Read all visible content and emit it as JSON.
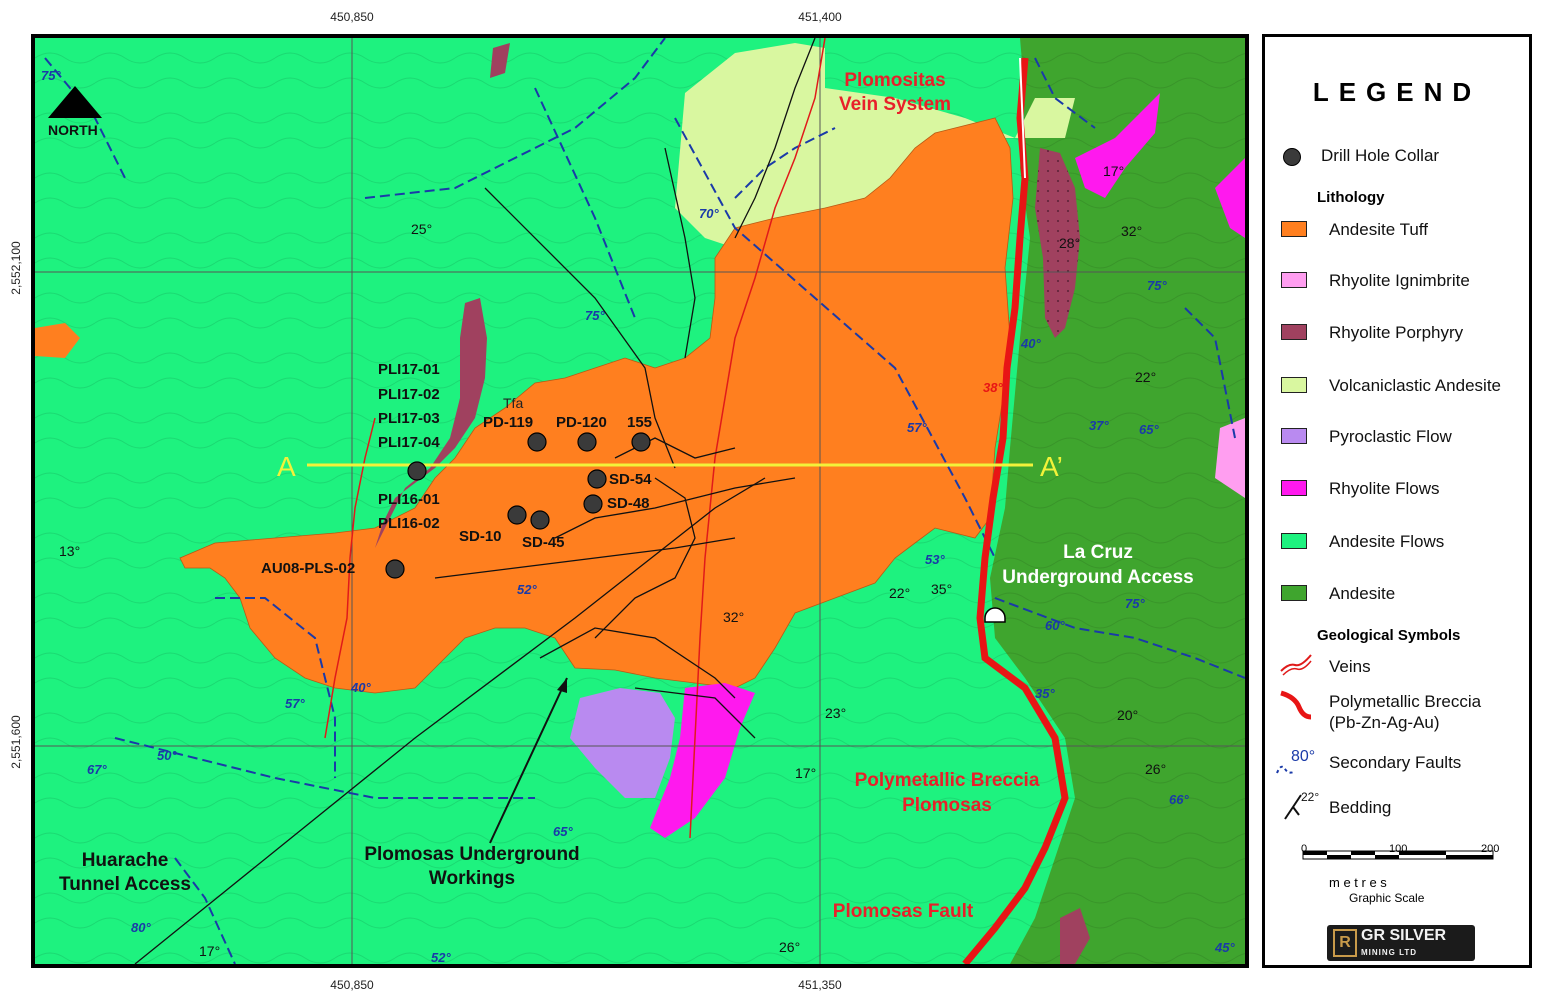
{
  "grid": {
    "top_labels": [
      "450,850",
      "451,400"
    ],
    "bottom_labels": [
      "450,850",
      "451,350"
    ],
    "left_labels": [
      "2,552,100",
      "2,551,600"
    ]
  },
  "north": {
    "label": "NORTH"
  },
  "places": {
    "plomositas": [
      "Plomositas",
      "Vein System"
    ],
    "breccia": [
      "Polymetallic Breccia",
      "Plomosas"
    ],
    "fault": "Plomosas Fault",
    "la_cruz": [
      "La Cruz",
      "Underground Access"
    ],
    "huarache": [
      "Huarache",
      "Tunnel Access"
    ],
    "workings": [
      "Plomosas Underground",
      "Workings"
    ]
  },
  "section": {
    "a": "A",
    "a_prime": "A’"
  },
  "unit_label": "Tfa",
  "drill_labels": {
    "pli17_01": "PLI17-01",
    "pli17_02": "PLI17-02",
    "pli17_03": "PLI17-03",
    "pli17_04": "PLI17-04",
    "pli16_01": "PLI16-01",
    "pli16_02": "PLI16-02",
    "pd119": "PD-119",
    "pd120": "PD-120",
    "h155": "155",
    "sd54": "SD-54",
    "sd48": "SD-48",
    "sd10": "SD-10",
    "sd45": "SD-45",
    "au08": "AU08-PLS-02"
  },
  "fault_dips": [
    "75°",
    "70°",
    "75°",
    "57°",
    "53°",
    "40°",
    "57°",
    "50°",
    "67°",
    "65°",
    "80°",
    "52°",
    "52°",
    "38°",
    "40°",
    "75°",
    "37°",
    "65°",
    "60°",
    "75°",
    "35°",
    "66°",
    "45°"
  ],
  "bedding_dips": [
    "25°",
    "13°",
    "17°",
    "23°",
    "22°",
    "35°",
    "32°",
    "17°",
    "26°",
    "26°",
    "20°",
    "28°",
    "32°",
    "22°",
    "17°"
  ],
  "legend": {
    "title": "LEGEND",
    "drill_collar": "Drill Hole Collar",
    "lithology_heading": "Lithology",
    "lithology": [
      {
        "label": "Andesite Tuff",
        "color": "#ff7f1f"
      },
      {
        "label": "Rhyolite Ignimbrite",
        "color": "#ff9ef0"
      },
      {
        "label": "Rhyolite Porphyry",
        "color": "#a0415f"
      },
      {
        "label": "Volcaniclastic Andesite",
        "color": "#d9f7a0"
      },
      {
        "label": "Pyroclastic Flow",
        "color": "#b98af0"
      },
      {
        "label": "Rhyolite Flows",
        "color": "#ff19ee"
      },
      {
        "label": "Andesite Flows",
        "color": "#1ef27f"
      },
      {
        "label": "Andesite",
        "color": "#3fa52e"
      }
    ],
    "symbols_heading": "Geological Symbols",
    "veins": "Veins",
    "breccia": [
      "Polymetallic Breccia",
      "(Pb-Zn-Ag-Au)"
    ],
    "faults_dip": "80°",
    "faults": "Secondary Faults",
    "bedding_dip": "22°",
    "bedding": "Bedding",
    "scale": {
      "ticks": [
        "0",
        "100",
        "200"
      ],
      "units": "m e t r e s",
      "caption": "Graphic Scale"
    },
    "logo": {
      "line1": "GR SILVER",
      "line2": "MINING LTD"
    }
  }
}
